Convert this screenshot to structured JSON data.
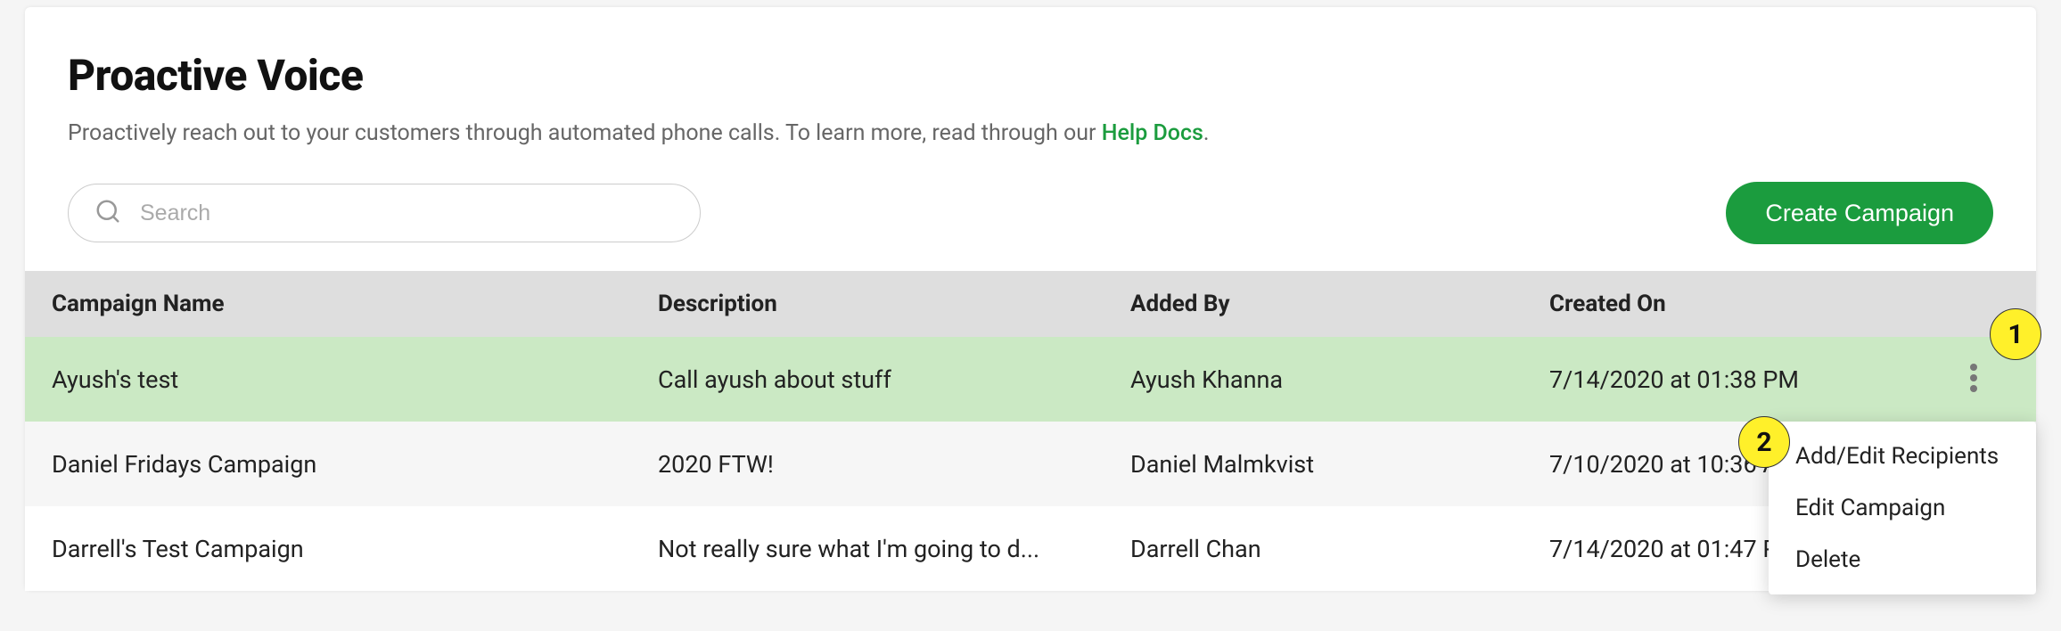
{
  "header": {
    "title": "Proactive Voice",
    "subtitle_prefix": "Proactively reach out to your customers through automated phone calls. To learn more, read through our ",
    "help_link_text": "Help Docs",
    "subtitle_suffix": "."
  },
  "toolbar": {
    "search_placeholder": "Search",
    "create_button_label": "Create Campaign"
  },
  "table": {
    "columns": {
      "name": "Campaign Name",
      "description": "Description",
      "added_by": "Added By",
      "created_on": "Created On"
    },
    "rows": [
      {
        "name": "Ayush's test",
        "description": "Call ayush about stuff",
        "added_by": "Ayush Khanna",
        "created_on": "7/14/2020 at 01:38 PM"
      },
      {
        "name": "Daniel Fridays Campaign",
        "description": "2020 FTW!",
        "added_by": "Daniel Malmkvist",
        "created_on": "7/10/2020 at 10:36 AM"
      },
      {
        "name": "Darrell's Test Campaign",
        "description": "Not really sure what I'm going to d...",
        "added_by": "Darrell Chan",
        "created_on": "7/14/2020 at 01:47 PM"
      }
    ]
  },
  "context_menu": {
    "items": [
      "Add/Edit Recipients",
      "Edit Campaign",
      "Delete"
    ]
  },
  "annotations": {
    "marker1": "1",
    "marker2": "2"
  }
}
